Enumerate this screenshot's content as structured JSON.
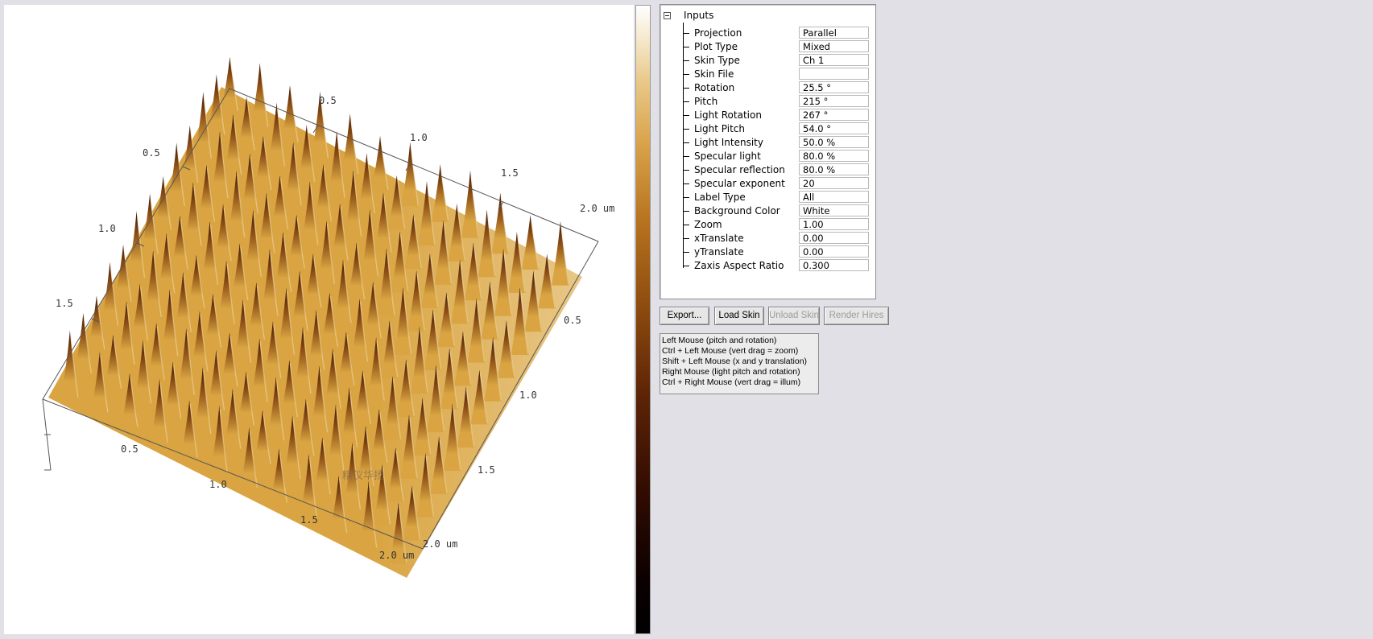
{
  "plot": {
    "top_axis_ticks": [
      "0.5",
      "1.0",
      "1.5",
      "2.0 um"
    ],
    "left_axis_ticks": [
      "0.5",
      "1.0",
      "1.5"
    ],
    "right_axis_ticks": [
      "0.5",
      "1.0",
      "1.5",
      "2.0 um"
    ],
    "bottom_axis_ticks": [
      "0.5",
      "1.0",
      "1.5",
      "2.0 um"
    ],
    "watermark": "精仪华扬",
    "colors": {
      "peak_dark": "#3a1204",
      "mid_brown": "#8c4e14",
      "surface_gold": "#d9a441",
      "highlight": "#f4e4c0",
      "background": "#ffffff"
    }
  },
  "inputs": {
    "title": "Inputs",
    "properties": [
      {
        "name": "Projection",
        "value": "Parallel"
      },
      {
        "name": "Plot Type",
        "value": "Mixed"
      },
      {
        "name": "Skin Type",
        "value": "Ch 1"
      },
      {
        "name": "Skin File",
        "value": ""
      },
      {
        "name": "Rotation",
        "value": "25.5 °"
      },
      {
        "name": "Pitch",
        "value": "215 °"
      },
      {
        "name": "Light Rotation",
        "value": "267 °"
      },
      {
        "name": "Light Pitch",
        "value": "54.0 °"
      },
      {
        "name": "Light Intensity",
        "value": "50.0 %"
      },
      {
        "name": "Specular light",
        "value": "80.0 %"
      },
      {
        "name": "Specular reflection",
        "value": "80.0 %"
      },
      {
        "name": "Specular exponent",
        "value": "20"
      },
      {
        "name": "Label Type",
        "value": "All"
      },
      {
        "name": "Background Color",
        "value": "White"
      },
      {
        "name": "Zoom",
        "value": "1.00"
      },
      {
        "name": "xTranslate",
        "value": "0.00"
      },
      {
        "name": "yTranslate",
        "value": "0.00"
      },
      {
        "name": "Zaxis Aspect Ratio",
        "value": "0.300"
      }
    ]
  },
  "buttons": {
    "export": "Export...",
    "load_skin": "Load Skin",
    "unload_skin": "Unload Skin",
    "render_hires": "Render Hires"
  },
  "help": {
    "lines": [
      "Left Mouse (pitch and rotation)",
      "Ctrl + Left Mouse (vert drag = zoom)",
      "Shift + Left Mouse (x and y translation)",
      "Right Mouse (light pitch and rotation)",
      "Ctrl + Right Mouse (vert drag = illum)"
    ]
  }
}
